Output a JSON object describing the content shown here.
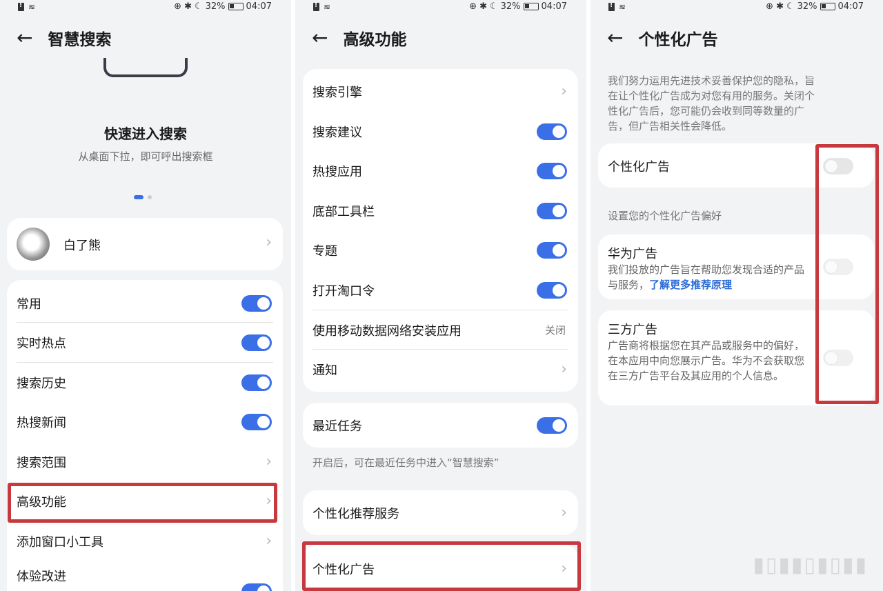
{
  "status": {
    "battery": "32%",
    "time": "04:07"
  },
  "panel1": {
    "title": "智慧搜索",
    "promo": {
      "title": "快速进入搜索",
      "subtitle": "从桌面下拉，即可呼出搜索框"
    },
    "profile": {
      "name": "白了熊"
    },
    "items": [
      {
        "label": "常用",
        "state": "on"
      },
      {
        "label": "实时热点",
        "state": "on"
      },
      {
        "label": "搜索历史",
        "state": "on"
      },
      {
        "label": "热搜新闻",
        "state": "on"
      },
      {
        "label": "搜索范围",
        "state": "chevron"
      },
      {
        "label": "高级功能",
        "state": "chevron"
      },
      {
        "label": "添加窗口小工具",
        "state": "chevron"
      },
      {
        "label": "体验改进",
        "state": "on"
      }
    ]
  },
  "panel2": {
    "title": "高级功能",
    "items": [
      {
        "label": "搜索引擎",
        "state": "chevron"
      },
      {
        "label": "搜索建议",
        "state": "on"
      },
      {
        "label": "热搜应用",
        "state": "on"
      },
      {
        "label": "底部工具栏",
        "state": "on"
      },
      {
        "label": "专题",
        "state": "on"
      },
      {
        "label": "打开淘口令",
        "state": "on"
      },
      {
        "label": "使用移动数据网络安装应用",
        "state": "value",
        "value": "关闭"
      },
      {
        "label": "通知",
        "state": "chevron"
      }
    ],
    "recent": {
      "label": "最近任务",
      "note": "开启后，可在最近任务中进入“智慧搜索”"
    },
    "personal_rec": {
      "label": "个性化推荐服务"
    },
    "personal_ad": {
      "label": "个性化广告"
    }
  },
  "panel3": {
    "title": "个性化广告",
    "intro": "我们努力运用先进技术妥善保护您的隐私，旨在让个性化广告成为对您有用的服务。关闭个性化广告后，您可能仍会收到同等数量的广告，但广告相关性会降低。",
    "main_toggle": {
      "label": "个性化广告"
    },
    "section": "设置您的个性化广告偏好",
    "huawei": {
      "title": "华为广告",
      "desc": "我们投放的广告旨在帮助您发现合适的产品与服务，",
      "link": "了解更多推荐原理"
    },
    "third": {
      "title": "三方广告",
      "desc": "广告商将根据您在其产品或服务中的偏好，在本应用中向您展示广告。华为不会获取您在三方广告平台及其应用的个人信息。"
    }
  }
}
